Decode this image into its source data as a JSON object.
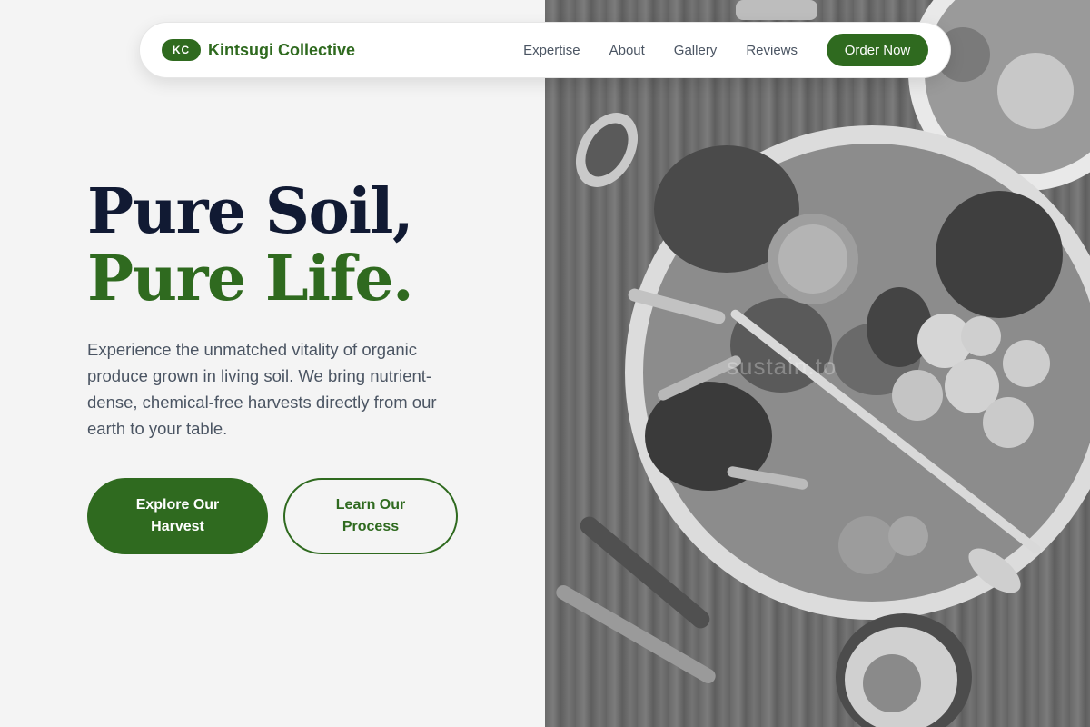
{
  "nav": {
    "badge": "KC",
    "brand": "Kintsugi Collective",
    "links": [
      "Expertise",
      "About",
      "Gallery",
      "Reviews"
    ],
    "cta": "Order Now"
  },
  "hero": {
    "title_line1": "Pure Soil,",
    "title_line2": "Pure Life.",
    "description": "Experience the unmatched vitality of organic produce grown in living soil. We bring nutrient-dense, chemical-free harvests directly from our earth to your table.",
    "primary_button": "Explore Our Harvest",
    "secondary_button": "Learn Our Process"
  },
  "image": {
    "watermark": "sustain.to",
    "subject": "grayscale overhead photo of salad bowl"
  },
  "colors": {
    "brand_green": "#2f6a1f",
    "heading_navy": "#111a33",
    "background": "#f4f4f4"
  }
}
